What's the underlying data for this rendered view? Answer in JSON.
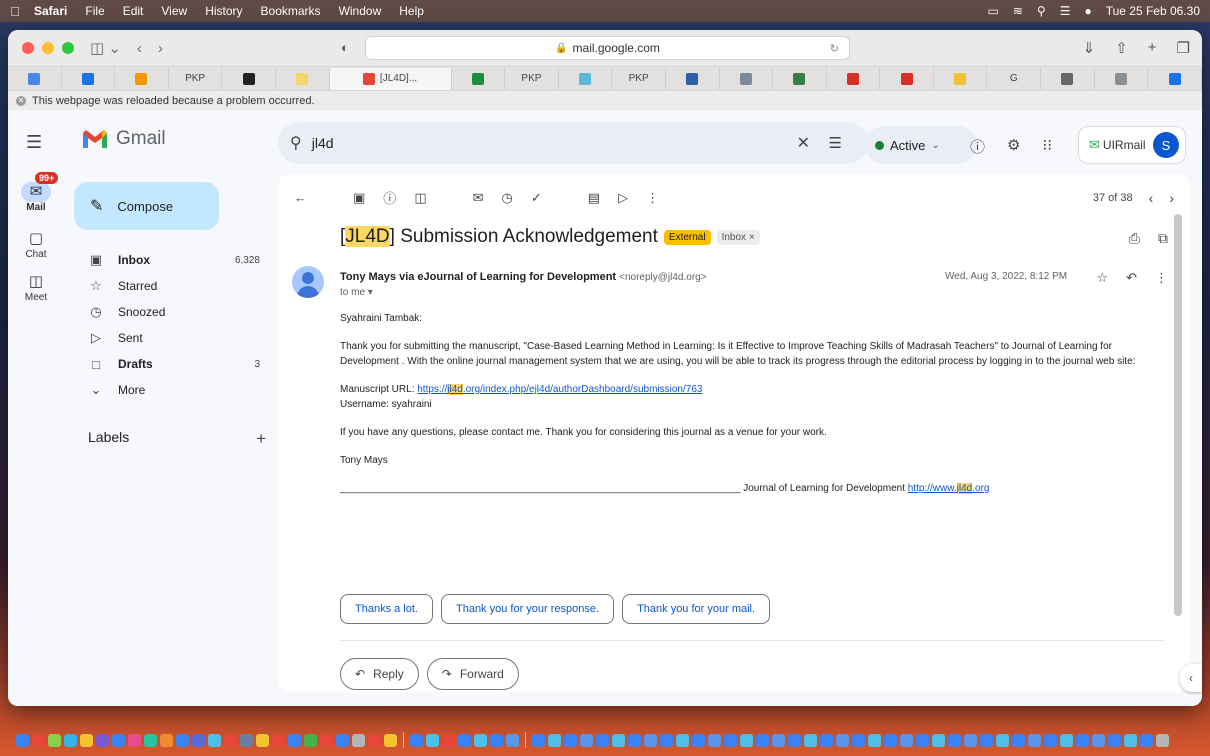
{
  "menubar": {
    "app": "Safari",
    "items": [
      "File",
      "Edit",
      "View",
      "History",
      "Bookmarks",
      "Window",
      "Help"
    ],
    "datetime": "Tue 25 Feb 06.30"
  },
  "browser": {
    "url": "mail.google.com",
    "tabs": [
      {
        "label": "",
        "color": "#4a86e8"
      },
      {
        "label": "",
        "color": "#1a73e8"
      },
      {
        "label": "",
        "color": "#f29900"
      },
      {
        "label": "PKP",
        "color": ""
      },
      {
        "label": "",
        "color": "#222222"
      },
      {
        "label": "",
        "color": "#f6d36b"
      },
      {
        "label": "[JL4D]...",
        "color": "#ea4335",
        "active": true
      },
      {
        "label": "",
        "color": "#1e8e3e"
      },
      {
        "label": "PKP",
        "color": ""
      },
      {
        "label": "",
        "color": "#5bb8d6"
      },
      {
        "label": "PKP",
        "color": ""
      },
      {
        "label": "",
        "color": "#2b5fa8"
      },
      {
        "label": "",
        "color": "#7a8a99"
      },
      {
        "label": "",
        "color": "#3a7d44"
      },
      {
        "label": "",
        "color": "#d93025"
      },
      {
        "label": "",
        "color": "#d93025"
      },
      {
        "label": "",
        "color": "#f2c230"
      },
      {
        "label": "G",
        "color": ""
      },
      {
        "label": "",
        "color": "#666666"
      },
      {
        "label": "",
        "color": "#8a8f94"
      },
      {
        "label": "",
        "color": "#1a73e8"
      }
    ],
    "notice": "This webpage was reloaded because a problem occurred."
  },
  "gmail": {
    "logo_text": "Gmail",
    "search_query": "jl4d",
    "status": "Active",
    "account_label": "UIRmail",
    "avatar_letter": "S",
    "rail": [
      {
        "label": "Mail",
        "badge": "99+"
      },
      {
        "label": "Chat"
      },
      {
        "label": "Meet"
      }
    ],
    "compose": "Compose",
    "nav": [
      {
        "label": "Inbox",
        "count": "6,328",
        "bold": true
      },
      {
        "label": "Starred",
        "count": ""
      },
      {
        "label": "Snoozed",
        "count": ""
      },
      {
        "label": "Sent",
        "count": ""
      },
      {
        "label": "Drafts",
        "count": "3",
        "bold": true
      },
      {
        "label": "More",
        "count": ""
      }
    ],
    "labels_heading": "Labels",
    "pager": "37 of 38",
    "email": {
      "subject_prefix": "JL4D",
      "subject_rest": " Submission Acknowledgement",
      "tag_external": "External",
      "tag_inbox": "Inbox ×",
      "sender_name": "Tony Mays via eJournal of Learning for Development",
      "sender_email": "<noreply@jl4d.org>",
      "to": "to me",
      "date": "Wed, Aug 3, 2022, 8:12 PM",
      "greeting": "Syahraini Tambak:",
      "para1": "Thank you for submitting the manuscript, \"Case-Based Learning Method in Learning: Is it Effective to Improve Teaching Skills of Madrasah Teachers\" to Journal of Learning for Development . With the online journal management system that we are using, you will be able to track its progress through the editorial process by logging in to the journal web site:",
      "url_label": "Manuscript URL: ",
      "url_pre": "https://",
      "url_hl": "jl4d",
      "url_post": ".org/index.php/ejl4d/authorDashboard/submission/763",
      "username": "Username: syahraini",
      "para2": "If you have any questions, please contact me. Thank you for considering this journal as a venue for your work.",
      "signature": "Tony Mays",
      "footer_line": "________________________________________________________________________ Journal of Learning for Development ",
      "footer_link_pre": "http://www.",
      "footer_link_hl": "jl4d",
      "footer_link_post": ".org"
    },
    "smart_replies": [
      "Thanks a lot.",
      "Thank you for your response.",
      "Thank you for your mail."
    ],
    "reply_label": "Reply",
    "forward_label": "Forward"
  },
  "dock_colors": [
    "#3b82f6",
    "#e8463a",
    "#8ad04a",
    "#2fb5e8",
    "#f4c430",
    "#7a59d0",
    "#3b82f6",
    "#e94b8b",
    "#24c6a0",
    "#f08c2e",
    "#3b82f6",
    "#5a6bd8",
    "#4cc0e8",
    "#e8463a",
    "#6a7fa0",
    "#f4c430",
    "#e8463a",
    "#3b82f6",
    "#47b04b",
    "#e8463a",
    "#3b82f6",
    "#b5b5b5",
    "#e8463a",
    "#f4c430",
    "#3b82f6",
    "#4cc0e8",
    "#e8463a",
    "#3b82f6",
    "#4cc0e8",
    "#3b82f6",
    "#5a95e8",
    "#3b82f6",
    "#4cc0e8",
    "#3b82f6",
    "#5a95e8",
    "#3b82f6",
    "#4cc0e8",
    "#3b82f6",
    "#5a95e8",
    "#3b82f6",
    "#4cc0e8",
    "#3b82f6",
    "#5a95e8",
    "#3b82f6",
    "#4cc0e8",
    "#3b82f6",
    "#5a95e8",
    "#3b82f6",
    "#4cc0e8",
    "#3b82f6",
    "#5a95e8",
    "#3b82f6",
    "#4cc0e8",
    "#3b82f6",
    "#5a95e8",
    "#3b82f6",
    "#4cc0e8",
    "#3b82f6",
    "#5a95e8",
    "#3b82f6",
    "#4cc0e8",
    "#3b82f6",
    "#5a95e8",
    "#3b82f6",
    "#4cc0e8",
    "#3b82f6",
    "#5a95e8",
    "#3b82f6",
    "#4cc0e8",
    "#3b82f6",
    "#b5b5b5"
  ]
}
